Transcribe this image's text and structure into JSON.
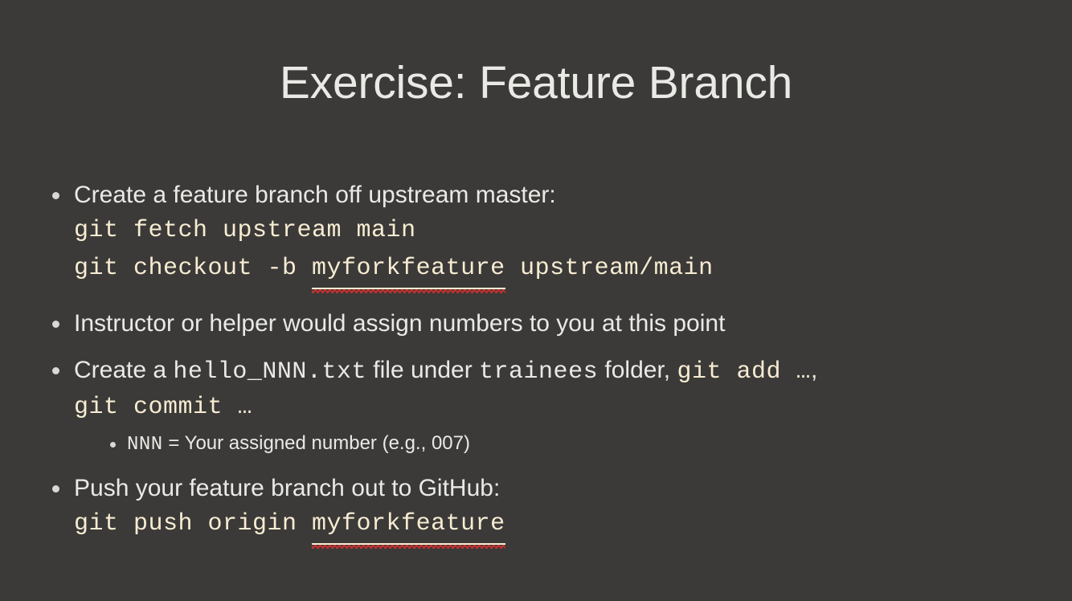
{
  "slide": {
    "title": "Exercise: Feature Branch",
    "background_color": "#3b3a38",
    "body_text_color": "#e9e9e6",
    "code_text_color": "#f7ecd2",
    "spellcheck_underline_color": "#c43030"
  },
  "bullets": {
    "b1": {
      "text": "Create a feature branch off upstream master:",
      "code1": "git fetch upstream main",
      "code2_a": "git checkout -b ",
      "code2_b": "myforkfeature",
      "code2_c": " upstream/main"
    },
    "b2": {
      "text": "Instructor or helper would assign numbers to you at this point"
    },
    "b3": {
      "part1": "Create a ",
      "file": "hello_NNN.txt",
      "part2": " file under ",
      "folder": "trainees",
      "part3": " folder, ",
      "cmd_add": "git add …",
      "part4": ",",
      "code_commit": "git commit …",
      "sub": {
        "code": "NNN",
        "text": " = Your assigned number (e.g., 007)"
      }
    },
    "b4": {
      "text": "Push your feature branch out to GitHub:",
      "code_a": "git push origin ",
      "code_b": "myforkfeature"
    }
  }
}
